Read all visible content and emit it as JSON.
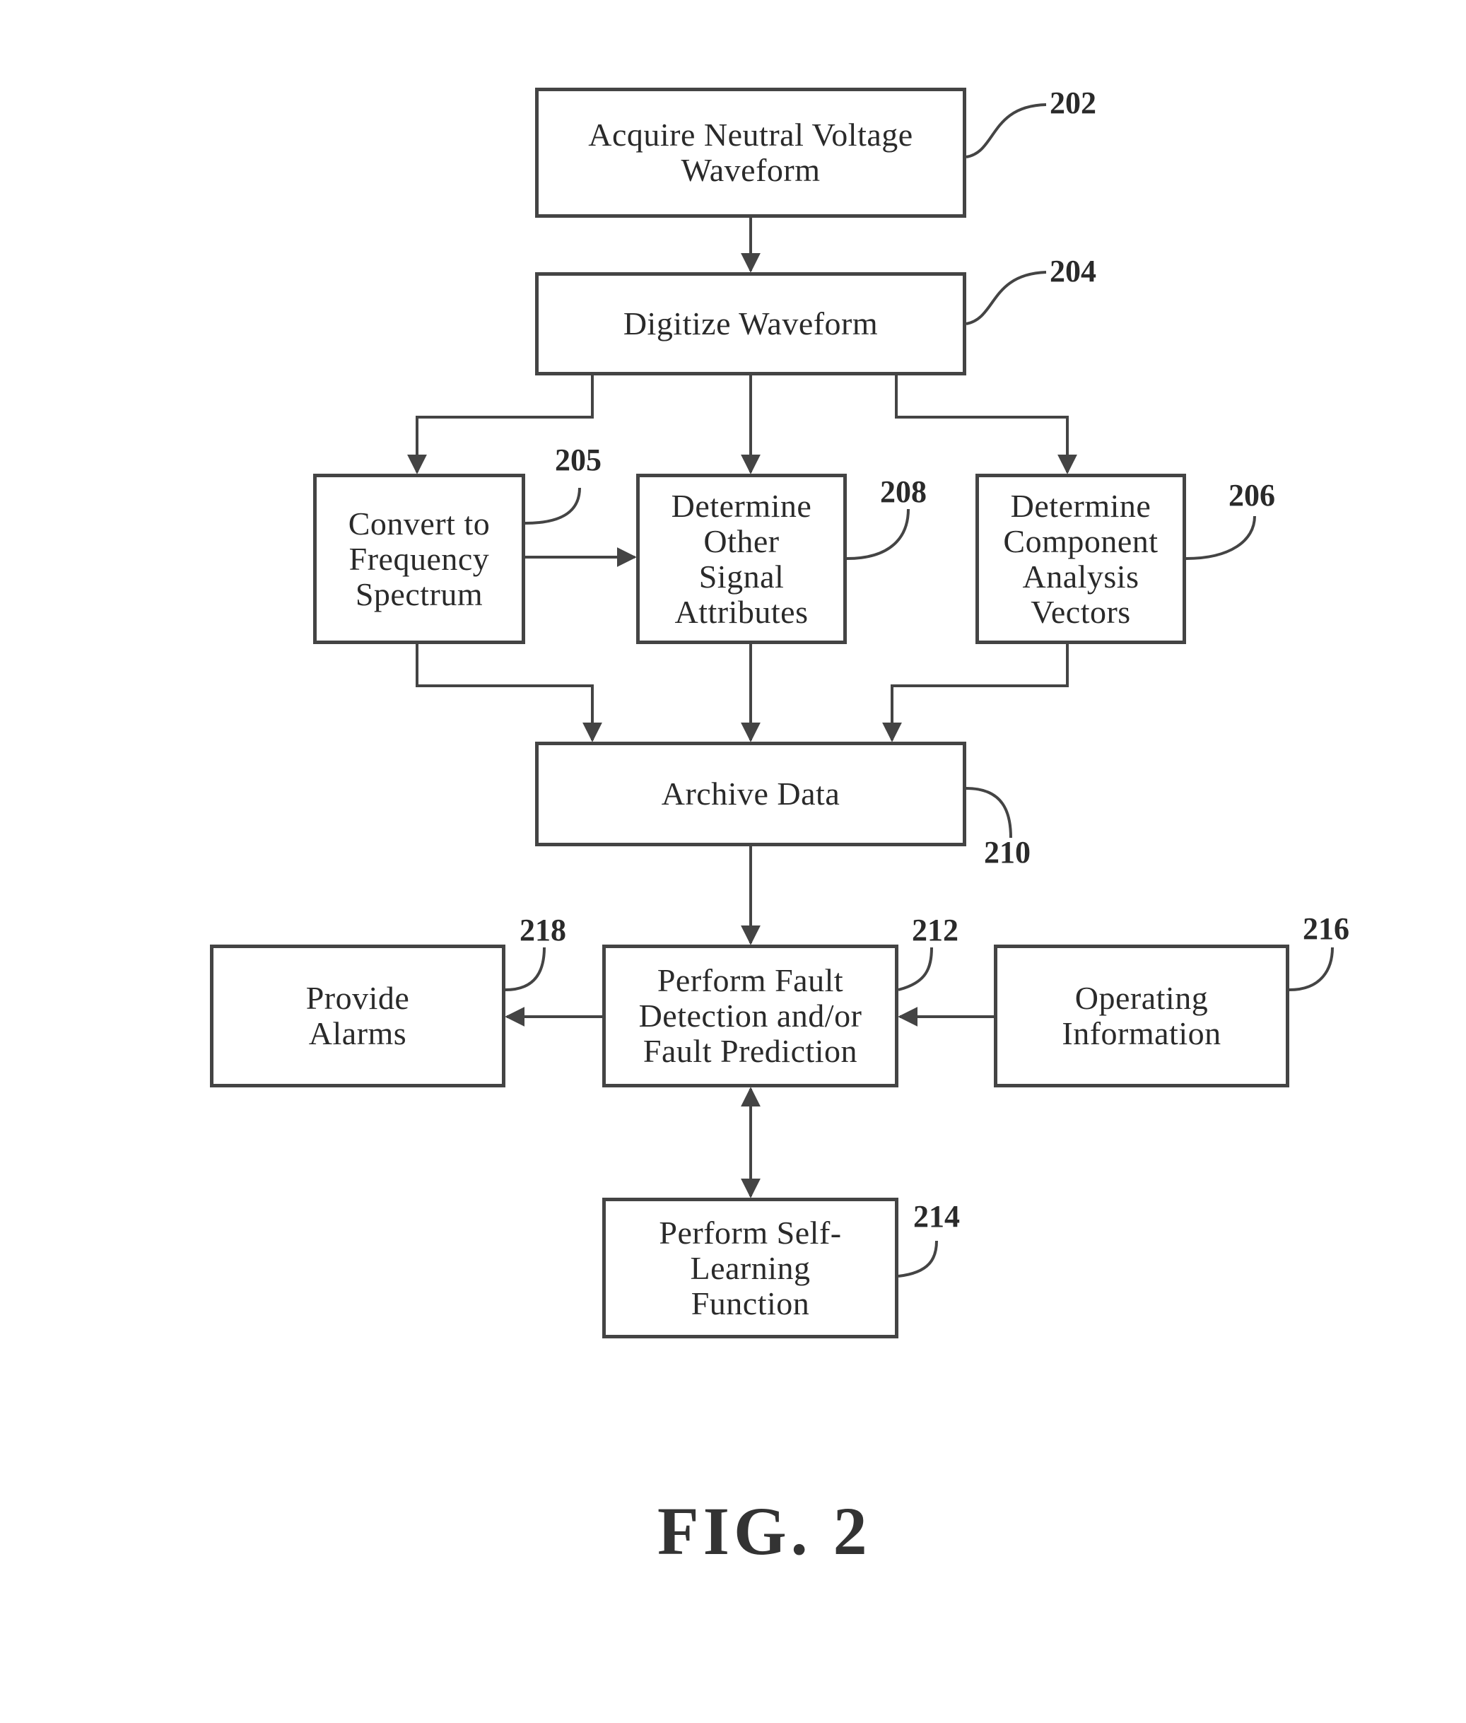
{
  "figure": {
    "title": "FIG. 2"
  },
  "boxes": {
    "b202": {
      "label": "Acquire Neutral Voltage\nWaveform",
      "ref": "202"
    },
    "b204": {
      "label": "Digitize  Waveform",
      "ref": "204"
    },
    "b205": {
      "label": "Convert to\nFrequency\nSpectrum",
      "ref": "205"
    },
    "b208": {
      "label": "Determine\nOther\nSignal\nAttributes",
      "ref": "208"
    },
    "b206": {
      "label": "Determine\nComponent\nAnalysis\nVectors",
      "ref": "206"
    },
    "b210": {
      "label": "Archive Data",
      "ref": "210"
    },
    "b218": {
      "label": "Provide\nAlarms",
      "ref": "218"
    },
    "b212": {
      "label": "Perform Fault\nDetection and/or\nFault Prediction",
      "ref": "212"
    },
    "b216": {
      "label": "Operating\nInformation",
      "ref": "216"
    },
    "b214": {
      "label": "Perform Self-\nLearning\nFunction",
      "ref": "214"
    }
  },
  "connections": [
    {
      "from": "202",
      "to": "204"
    },
    {
      "from": "204",
      "to": "205"
    },
    {
      "from": "204",
      "to": "208"
    },
    {
      "from": "204",
      "to": "206"
    },
    {
      "from": "205",
      "to": "208"
    },
    {
      "from": "205",
      "to": "210"
    },
    {
      "from": "208",
      "to": "210"
    },
    {
      "from": "206",
      "to": "210"
    },
    {
      "from": "210",
      "to": "212"
    },
    {
      "from": "212",
      "to": "218"
    },
    {
      "from": "216",
      "to": "212"
    },
    {
      "from": "212",
      "to": "214",
      "bidirectional": true
    }
  ]
}
